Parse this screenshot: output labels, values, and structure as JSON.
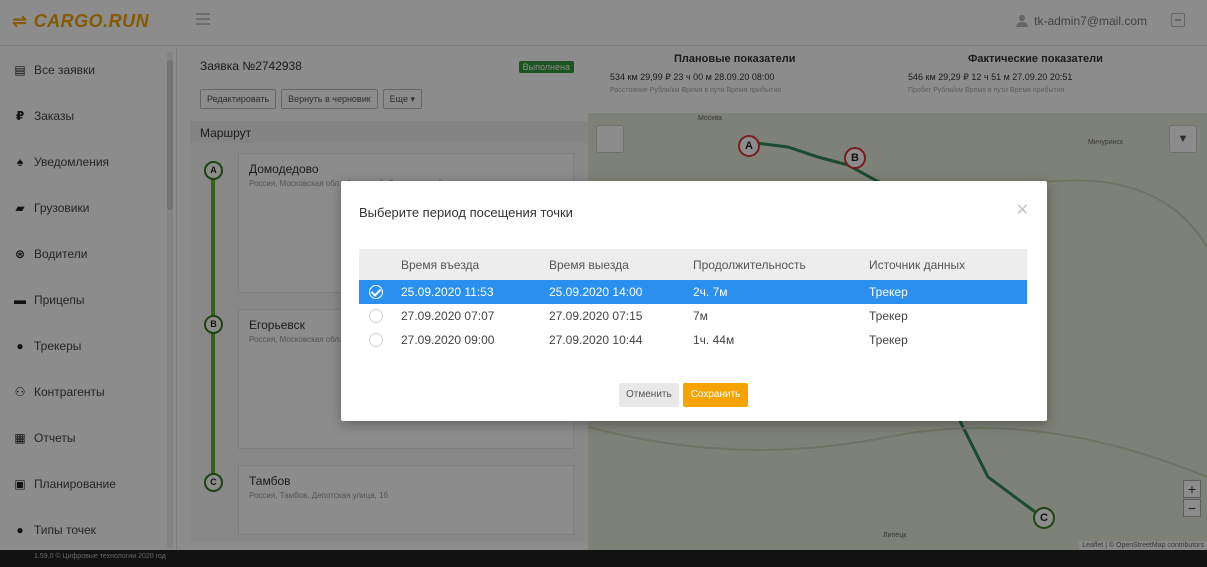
{
  "brand": {
    "name": "CARGO.RUN",
    "color": "#f2a500"
  },
  "header": {
    "user_email": "tk-admin7@mail.com"
  },
  "sidebar": {
    "items": [
      {
        "label": "Все заявки",
        "icon": "clipboard-icon"
      },
      {
        "label": "Заказы",
        "icon": "ruble-icon"
      },
      {
        "label": "Уведомления",
        "icon": "bell-icon"
      },
      {
        "label": "Грузовики",
        "icon": "truck-icon"
      },
      {
        "label": "Водители",
        "icon": "steering-wheel-icon"
      },
      {
        "label": "Прицепы",
        "icon": "trailer-icon"
      },
      {
        "label": "Трекеры",
        "icon": "map-pin-icon"
      },
      {
        "label": "Контрагенты",
        "icon": "people-icon"
      },
      {
        "label": "Отчеты",
        "icon": "report-icon"
      },
      {
        "label": "Планирование",
        "icon": "calendar-icon"
      },
      {
        "label": "Типы точек",
        "icon": "point-type-icon"
      }
    ]
  },
  "order": {
    "title": "Заявка №2742938",
    "status": "Выполнена",
    "buttons": {
      "edit": "Редактировать",
      "revert": "Вернуть в черновик",
      "more": "Еще ▾"
    },
    "route_label": "Маршрут",
    "stops": [
      {
        "letter": "A",
        "city": "Домодедово",
        "address": "Россия, Московская обл., Северный, Логистический"
      },
      {
        "letter": "B",
        "city": "Егорьевск",
        "address": "Россия, Московская обл., улица, 9"
      },
      {
        "letter": "C",
        "city": "Тамбов",
        "address": "Россия, Тамбов, Депотская улица, 1б"
      }
    ]
  },
  "stats": {
    "planned_header": "Плановые показатели",
    "actual_header": "Фактические показатели",
    "planned_row": "534 км   29,99 ₽   23 ч 00 м   28.09.20 08:00",
    "actual_row": "546 км   29,29 ₽   12 ч 51 м   27.09.20 20:51",
    "planned_sub": "Расстояние   Рубли/км   Время в пути   Время прибытия",
    "actual_sub": "Пробег   Рубли/км   Время в пути   Время прибытия"
  },
  "map": {
    "markers": [
      "A",
      "B",
      "C"
    ],
    "attribution": "Leaflet | © OpenStreetMap contributors",
    "labels": [
      "Москва",
      "Мичуринск",
      "Липецк"
    ]
  },
  "footer": {
    "text": "1.59.0 © Цифровые технологии 2020 год"
  },
  "modal": {
    "title": "Выберите период посещения точки",
    "columns": [
      "Время въезда",
      "Время выезда",
      "Продолжительность",
      "Источник данных"
    ],
    "rows": [
      {
        "in": "25.09.2020 11:53",
        "out": "25.09.2020 14:00",
        "duration": "2ч. 7м",
        "source": "Трекер",
        "selected": true
      },
      {
        "in": "27.09.2020 07:07",
        "out": "27.09.2020 07:15",
        "duration": "7м",
        "source": "Трекер",
        "selected": false
      },
      {
        "in": "27.09.2020 09:00",
        "out": "27.09.2020 10:44",
        "duration": "1ч. 44м",
        "source": "Трекер",
        "selected": false
      }
    ],
    "cancel_label": "Отменить",
    "save_label": "Сохранить"
  },
  "colors": {
    "selected_row": "#2b8ff0",
    "save_button": "#f5a300",
    "route_line": "#6ab02c"
  }
}
